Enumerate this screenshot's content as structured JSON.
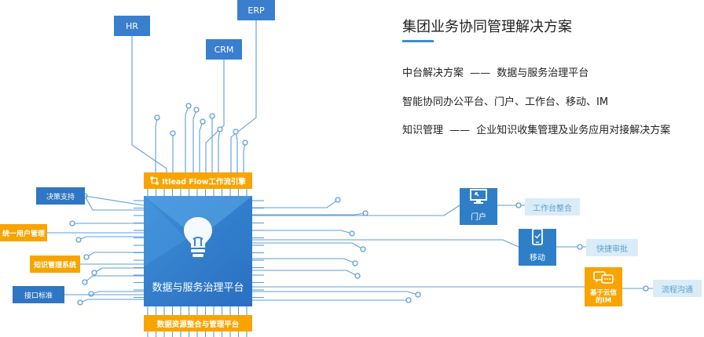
{
  "header": {
    "title": "集团业务协同管理解决方案",
    "rows": [
      {
        "label": "中台解决方案",
        "sep": "——",
        "value": "数据与服务治理平台"
      },
      {
        "label": "智能协同办公平台、门户、工作台、移动、IM",
        "sep": "",
        "value": ""
      },
      {
        "label": "知识管理",
        "sep": "——",
        "value": "企业知识收集管理及业务应用对接解决方案"
      }
    ]
  },
  "systems": {
    "hr": "HR",
    "crm": "CRM",
    "erp": "ERP"
  },
  "left_tags": [
    "决策支持",
    "统一用户管理",
    "知识管理系统",
    "接口标准"
  ],
  "chip": {
    "top_label": "Itlead Flow工作流引擎",
    "center_label": "数据与服务治理平台",
    "bottom_label": "数据资源整合与管理平台"
  },
  "right": {
    "portal": "门户",
    "mobile": "移动",
    "im": "基于云信的IM",
    "targets": [
      "工作台整合",
      "快捷审批",
      "流程沟通"
    ]
  },
  "colors": {
    "primary_blue": "#2f7ec8",
    "orange": "#f7a400",
    "line": "#5e9fd8",
    "light_pill": "#d9ecf8"
  }
}
